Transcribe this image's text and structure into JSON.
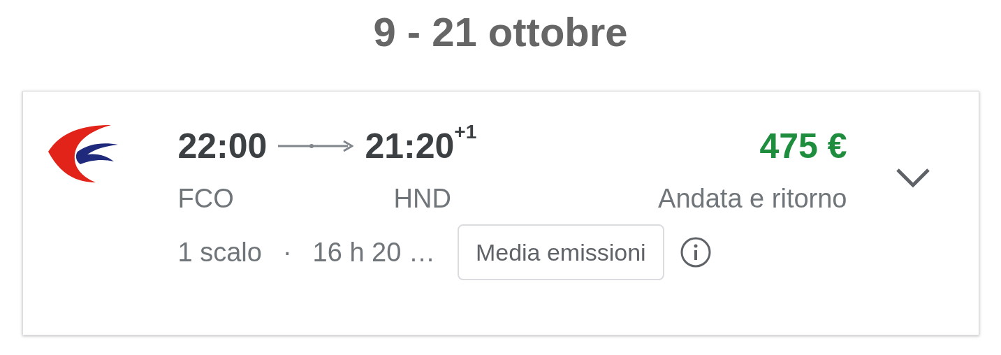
{
  "heading": "9 - 21 ottobre",
  "flight": {
    "departure_time": "22:00",
    "arrival_time": "21:20",
    "day_offset": "+1",
    "price": "475 €",
    "origin": "FCO",
    "destination": "HND",
    "trip_type": "Andata e ritorno",
    "stops": "1 scalo",
    "separator": "·",
    "duration": "16 h 20 …",
    "emissions": "Media emissioni",
    "expanded": false
  }
}
